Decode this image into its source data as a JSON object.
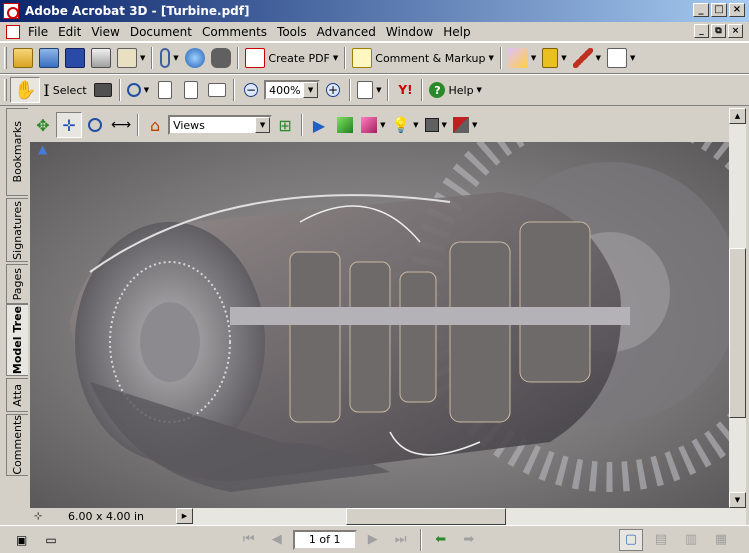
{
  "window": {
    "title": "Adobe Acrobat 3D - [Turbine.pdf]",
    "buttons": [
      "_",
      "□",
      "×"
    ]
  },
  "menubar": {
    "items": [
      "File",
      "Edit",
      "View",
      "Document",
      "Comments",
      "Tools",
      "Advanced",
      "Window",
      "Help"
    ],
    "mdi_buttons": [
      "_",
      "⧉",
      "×"
    ]
  },
  "toolbar1": {
    "create_pdf_label": "Create PDF",
    "comment_markup_label": "Comment & Markup"
  },
  "toolbar2": {
    "select_label": "Select",
    "zoom_value": "400%",
    "help_label": "Help"
  },
  "toolbar3": {
    "views_value": "Views"
  },
  "sidetabs": [
    "Bookmarks",
    "Signatures",
    "Pages",
    "Model Tree",
    "Atta",
    "Comments"
  ],
  "status": {
    "page_size": "6.00 x 4.00 in",
    "page_indicator": "1 of 1"
  },
  "colors": {
    "titlebar_start": "#0a246a",
    "titlebar_end": "#a6caf0",
    "chrome": "#d4d0c8"
  }
}
